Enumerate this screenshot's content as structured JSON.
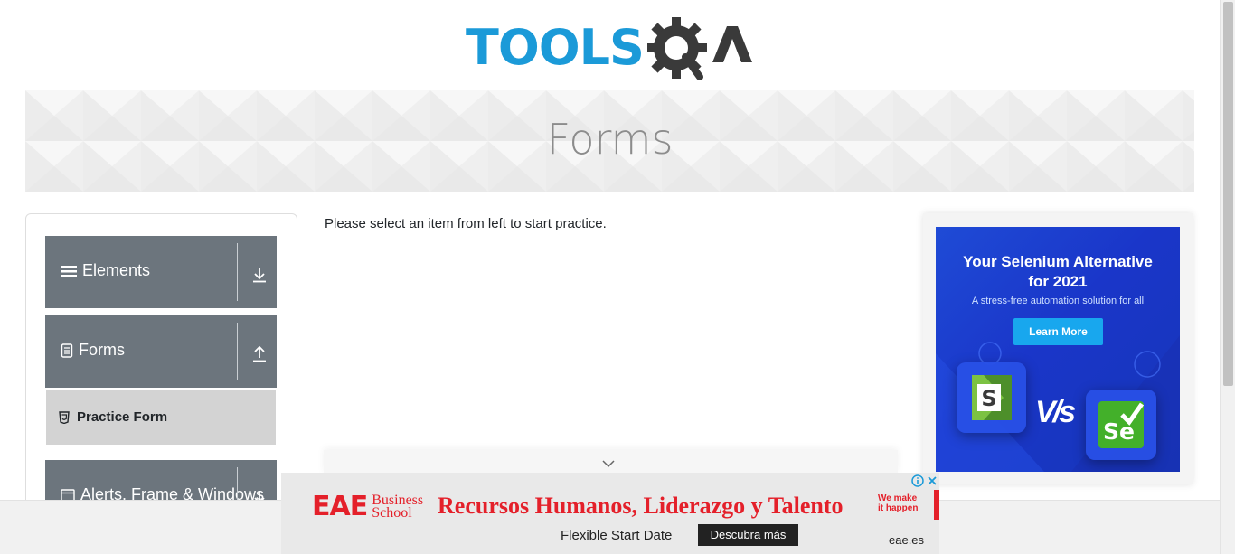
{
  "logo": {
    "text": "TOOLS",
    "suffix": "QA",
    "brand_color": "#1b9ad8"
  },
  "banner": {
    "title": "Forms"
  },
  "sidebar": {
    "groups": [
      {
        "label": "Elements",
        "icon": "hamburger-icon",
        "arrow": "download-icon"
      },
      {
        "label": "Forms",
        "icon": "document-icon",
        "arrow": "upload-icon"
      },
      {
        "label": "Alerts, Frame & Windows",
        "icon": "window-icon",
        "arrow": "download-icon"
      }
    ],
    "active_item": {
      "label": "Practice Form",
      "icon": "html5-icon"
    }
  },
  "main": {
    "instruction": "Please select an item from left to start practice."
  },
  "right_ad": {
    "headline_1": "Your Selenium Alternative",
    "headline_2": "for 2021",
    "subtext": "A stress-free automation solution for all",
    "cta": "Learn More",
    "vs_text": "V/s",
    "se_text": "Se"
  },
  "bottom_ad": {
    "brand": "EAE",
    "brand_sub_1": "Business",
    "brand_sub_2": "School",
    "headline": "Recursos Humanos, Liderazgo y Talento",
    "tag_1": "We make",
    "tag_2": "it happen",
    "subtext": "Flexible Start Date",
    "cta": "Descubra más",
    "domain": "eae.es"
  },
  "colors": {
    "sidebar_group_bg": "#6c757d",
    "active_item_bg": "#d3d3d3",
    "ad_red": "#e4202a",
    "ad_blue": "#1f4bd6"
  }
}
